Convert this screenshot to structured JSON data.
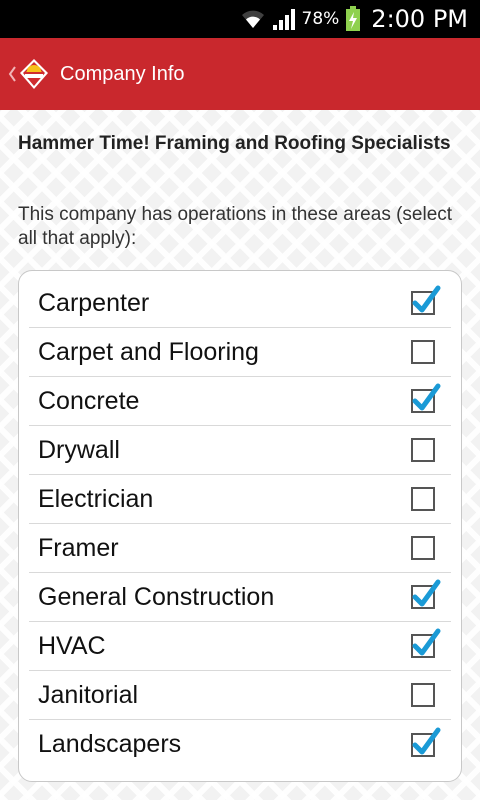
{
  "status_bar": {
    "wifi_icon": "wifi-icon",
    "signal_icon": "cell-signal-icon",
    "battery_percent": "78%",
    "battery_icon": "battery-charging-icon",
    "time": "2:00 PM"
  },
  "action_bar": {
    "title": "Company Info",
    "background": "#c9282d"
  },
  "company": {
    "name": "Hammer Time!  Framing and Roofing Specialists"
  },
  "instructions": "This company has operations in these areas (select all that apply):",
  "options": [
    {
      "label": "Carpenter",
      "checked": true
    },
    {
      "label": "Carpet and Flooring",
      "checked": false
    },
    {
      "label": "Concrete",
      "checked": true
    },
    {
      "label": "Drywall",
      "checked": false
    },
    {
      "label": "Electrician",
      "checked": false
    },
    {
      "label": "Framer",
      "checked": false
    },
    {
      "label": "General Construction",
      "checked": true
    },
    {
      "label": "HVAC",
      "checked": true
    },
    {
      "label": "Janitorial",
      "checked": false
    },
    {
      "label": "Landscapers",
      "checked": true
    }
  ],
  "colors": {
    "check_accent": "#1a9ad6",
    "brand_red": "#c9282d"
  }
}
